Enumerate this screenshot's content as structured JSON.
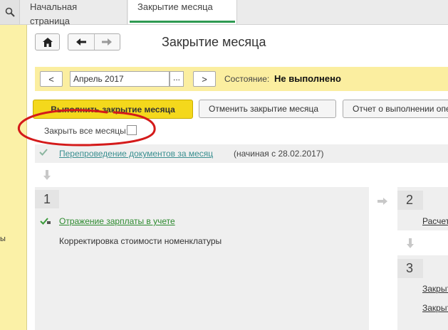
{
  "tabs": {
    "home_label": "Начальная страница",
    "active_label": "Закрытие месяца"
  },
  "left_panel": {
    "edge_text": "ы"
  },
  "header": {
    "title": "Закрытие месяца",
    "home_icon": "home-icon",
    "back_icon": "arrow-left-icon",
    "forward_icon": "arrow-right-icon"
  },
  "period": {
    "prev_label": "<",
    "value": "Апрель 2017",
    "choose_label": "...",
    "next_label": ">",
    "status_label": "Состояние:",
    "status_value": "Не выполнено"
  },
  "actions": {
    "run_label": "Выполнить закрытие месяца",
    "cancel_label": "Отменить закрытие месяца",
    "report_label": "Отчет о выполнении операций"
  },
  "options": {
    "all_months_label": "Закрыть все месяцы:",
    "all_months_checked": false
  },
  "repost": {
    "link_label": "Перепроведение документов за месяц",
    "note": "(начиная с 28.02.2017)"
  },
  "stages": [
    {
      "number": "1",
      "items": [
        {
          "label": "Отражение зарплаты в учете",
          "status": "done"
        },
        {
          "label": "Корректировка стоимости номенклатуры",
          "status": "pending"
        }
      ]
    },
    {
      "number": "2",
      "items": [
        {
          "label": "Расчет"
        }
      ]
    },
    {
      "number": "3",
      "items": [
        {
          "label": "Закрыт"
        },
        {
          "label": "Закрыт"
        }
      ]
    }
  ],
  "colors": {
    "accent_yellow": "#f4d81c",
    "period_bar": "#fbeea0",
    "left_panel": "#fbf1a7",
    "link_green": "#2d8a2f",
    "link_teal": "#3a8f90",
    "tab_underline": "#2f9a52",
    "annotation_red": "#d41a1a"
  }
}
